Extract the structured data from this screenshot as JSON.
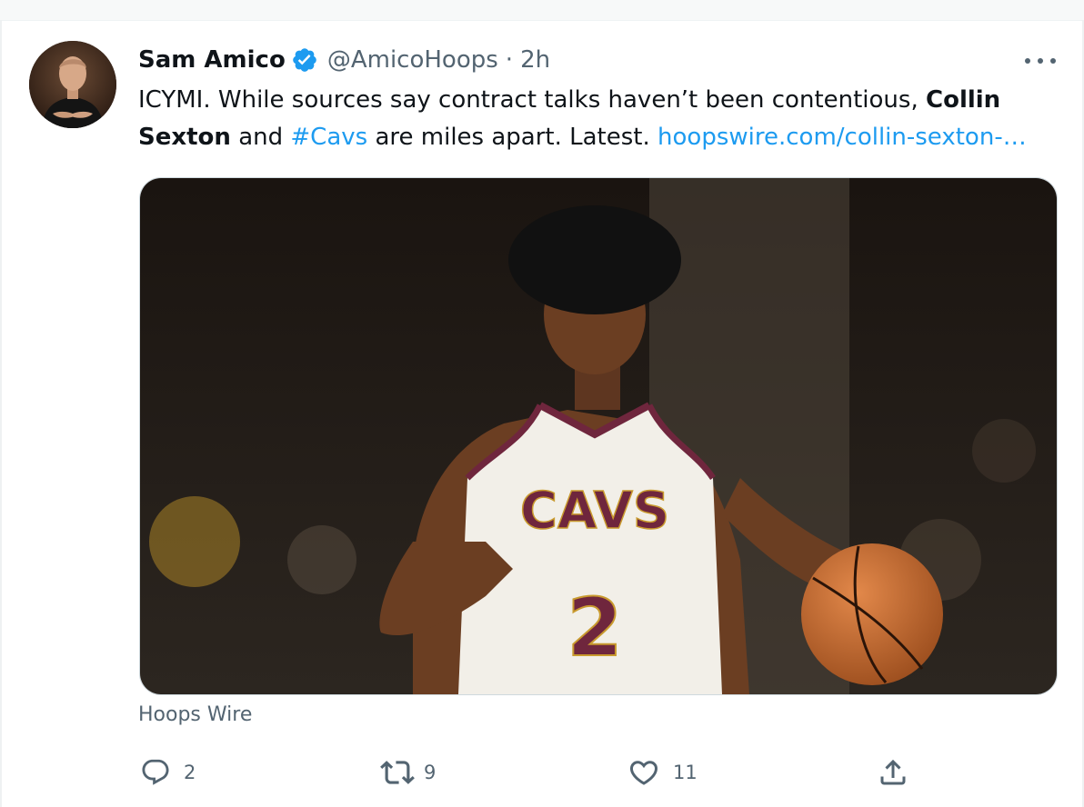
{
  "author": {
    "name": "Sam Amico",
    "handle": "@AmicoHoops",
    "separator": "·",
    "time": "2h"
  },
  "tweet": {
    "text_part1": "ICYMI. While sources say contract talks haven’t been contentious,",
    "bold1": "Collin",
    "bold2": "Sexton",
    "text_and": "and",
    "hashtag": "#Cavs",
    "text_part2": "are miles apart. Latest.",
    "link": "hoopswire.com/collin-sexton-…"
  },
  "media": {
    "jersey_team": "CAVS",
    "jersey_number": "2"
  },
  "card": {
    "source": "Hoops Wire"
  },
  "actions": {
    "replies": "2",
    "retweets": "9",
    "likes": "11"
  },
  "colors": {
    "link": "#1d9bf0",
    "text": "#0f1419",
    "muted": "#536471",
    "jersey_trim": "#6f263d"
  }
}
